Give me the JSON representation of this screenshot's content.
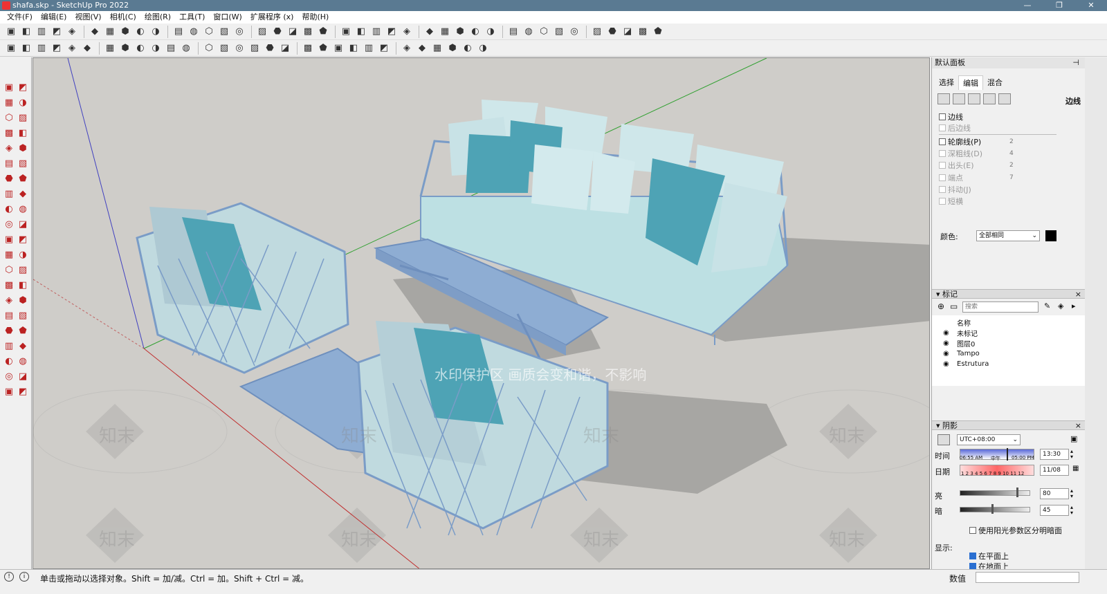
{
  "window": {
    "title": "shafa.skp - SketchUp Pro 2022",
    "buttons": [
      "—",
      "❐",
      "✕"
    ]
  },
  "menu": [
    "文件(F)",
    "编辑(E)",
    "视图(V)",
    "相机(C)",
    "绘图(R)",
    "工具(T)",
    "窗口(W)",
    "扩展程序 (x)",
    "帮助(H)"
  ],
  "toolbar1_icons": [
    "new-icon",
    "open-icon",
    "save-icon",
    "cut-icon",
    "copy-icon",
    "paste-icon",
    "erase-icon",
    "undo-icon",
    "redo-icon",
    "print-icon",
    "info-icon",
    "xray-icon",
    "wireframe-icon",
    "hidden-line-icon",
    "shaded-icon",
    "textured-icon",
    "monochrome-icon",
    "iso-view-icon",
    "top-view-icon",
    "front-view-icon",
    "right-view-icon",
    "back-view-icon",
    "left-view-icon",
    "bottom-view-icon",
    "components-icon",
    "materials-icon",
    "scenes-icon",
    "section-plane-icon",
    "section-cuts-icon",
    "section-fill-icon",
    "display-section-icon",
    "geo-location-icon",
    "sandbox-icon",
    "warehouse-icon",
    "extension-warehouse-icon",
    "layout-icon",
    "terrain-icon",
    "photo-match-icon",
    "match-photo-icon",
    "paint-icon"
  ],
  "toolbar2_icons": [
    "view-icon",
    "layer-icon",
    "outliner-icon",
    "follow-me-icon",
    "array-icon",
    "stairs-icon",
    "curve-icon",
    "fillet-icon",
    "chamfer-icon",
    "bezier-icon",
    "spline-icon",
    "extrude-icon",
    "loft-icon",
    "weld-icon",
    "explode-icon",
    "subdivide-icon",
    "smooth-icon",
    "joint-icon",
    "round-corner-icon",
    "shape-bender-icon",
    "flowify-icon",
    "fredo-icon",
    "soap-icon",
    "drape-icon",
    "skin-icon",
    "xy-icon",
    "bub-icon",
    "play-icon",
    "stop-icon",
    "render-icon"
  ],
  "left_tools": [
    "select-icon",
    "orbit-icon",
    "make-component-icon",
    "eraser-icon",
    "paint-bucket-icon",
    "tape-measure-icon",
    "line-icon",
    "freehand-icon",
    "rectangle-icon",
    "rotated-rectangle-icon",
    "circle-icon",
    "polygon-icon",
    "arc-icon",
    "pie-icon",
    "two-point-arc-icon",
    "three-point-arc-icon",
    "move-icon",
    "push-pull-icon",
    "rotate-icon",
    "follow-me-tool-icon",
    "scale-icon",
    "offset-icon",
    "tape-icon",
    "text-icon",
    "protractor-icon",
    "axes-icon",
    "dimension-icon",
    "3d-text-icon",
    "orbit-tool-icon",
    "pan-icon",
    "zoom-icon",
    "zoom-window-icon",
    "zoom-extents-icon",
    "previous-view-icon",
    "position-camera-icon",
    "look-around-icon",
    "walk-icon",
    "section-tool-icon",
    "sandbox-tool-icon",
    "smoove-icon",
    "stamp-icon",
    "flip-edge-icon"
  ],
  "viewport": {
    "watermark": "水印保护区  画质会变和谐，不影响",
    "watermark_logo": "知末"
  },
  "status": {
    "message": "单击或拖动以选择对象。Shift = 加/减。Ctrl = 加。Shift + Ctrl = 减。",
    "value_label": "数值"
  },
  "panel": {
    "title": "默认面板",
    "tabs": [
      "选择",
      "编辑",
      "混合"
    ],
    "edge_title": "边线",
    "edges": {
      "label": "边线",
      "back_edges": "后边线"
    },
    "options": [
      {
        "label": "轮廓线(P)",
        "value": "2",
        "enabled": true
      },
      {
        "label": "深粗线(D)",
        "value": "4",
        "enabled": false
      },
      {
        "label": "出头(E)",
        "value": "2",
        "enabled": false
      },
      {
        "label": "端点",
        "value": "7",
        "enabled": false
      },
      {
        "label": "抖动(J)",
        "value": "",
        "enabled": false
      },
      {
        "label": "短横",
        "value": "",
        "enabled": false
      }
    ],
    "color_label": "颜色:",
    "color_value": "全部相同",
    "tags": {
      "title": "标记",
      "search_placeholder": "搜索",
      "column_name": "名称",
      "items": [
        "未标记",
        "图层0",
        "Tampo",
        "Estrutura"
      ]
    },
    "shadows": {
      "title": "阴影",
      "timezone": "UTC+08:00",
      "time_label": "时间",
      "time_start": "06:55 AM",
      "time_mid": "中午",
      "time_end": "05:00 PM",
      "time_value": "13:30",
      "date_label": "日期",
      "months": "1 2 3 4 5 6 7 8 9 10 11 12",
      "date_value": "11/08",
      "light_label": "亮",
      "light_value": "80",
      "dark_label": "暗",
      "dark_value": "45",
      "sun_shading": "使用阳光参数区分明暗面",
      "display_label": "显示:",
      "on_faces": "在平面上",
      "on_ground": "在地面上"
    }
  }
}
